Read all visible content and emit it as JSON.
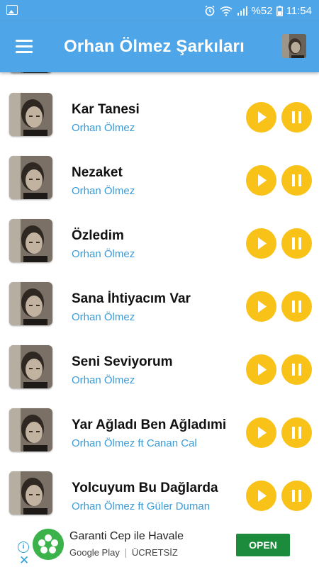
{
  "status_bar": {
    "battery": "%52",
    "time": "11:54"
  },
  "app_bar": {
    "title": "Orhan Ölmez Şarkıları"
  },
  "songs": [
    {
      "title": "Kar Tanesi",
      "artist": "Orhan Ölmez"
    },
    {
      "title": "Nezaket",
      "artist": "Orhan Ölmez"
    },
    {
      "title": "Özledim",
      "artist": "Orhan Ölmez"
    },
    {
      "title": "Sana İhtiyacım Var",
      "artist": "Orhan Ölmez"
    },
    {
      "title": "Seni Seviyorum",
      "artist": "Orhan Ölmez"
    },
    {
      "title": "Yar Ağladı Ben Ağladımi",
      "artist": "Orhan Ölmez ft Canan Cal"
    },
    {
      "title": "Yolcuyum Bu Dağlarda",
      "artist": "Orhan Ölmez ft Güler Duman"
    }
  ],
  "ad": {
    "title": "Garanti Cep ile Havale",
    "store": "Google Play",
    "price": "ÜCRETSİZ",
    "open_label": "OPEN"
  },
  "colors": {
    "accent": "#4ea5e7",
    "button": "#f8c219",
    "artist": "#3c9ad6",
    "ad_button": "#1d8b3c"
  }
}
